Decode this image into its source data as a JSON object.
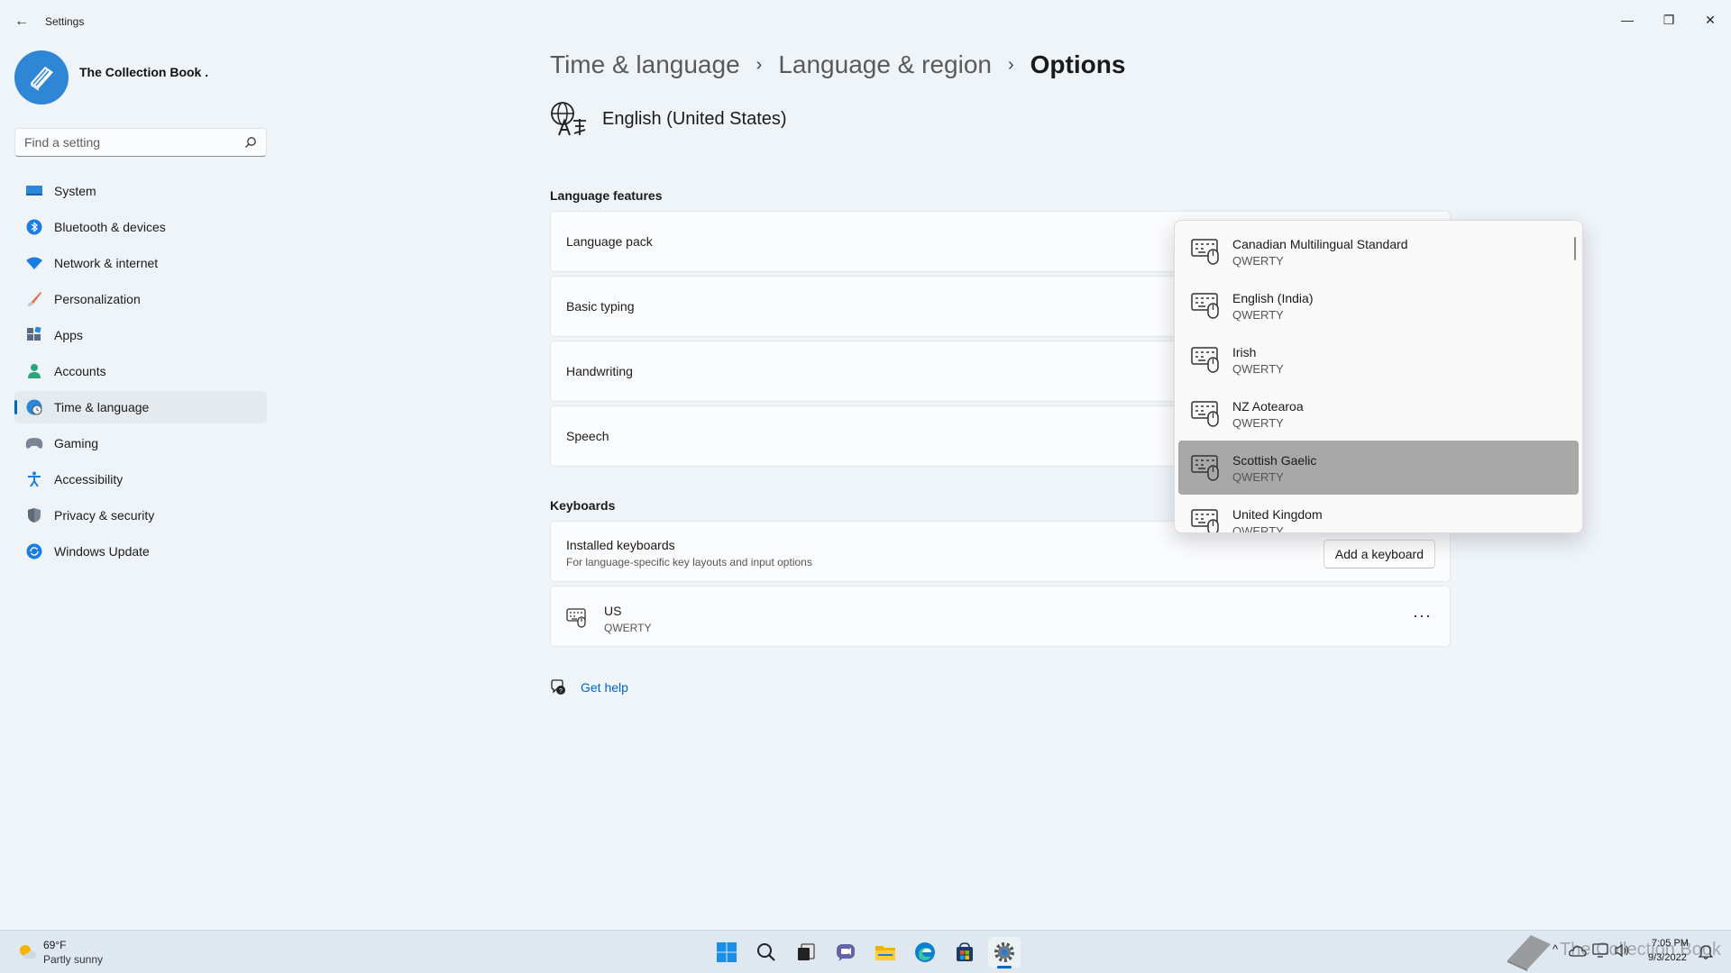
{
  "window": {
    "title": "Settings",
    "back_glyph": "←",
    "minimize_glyph": "—",
    "maximize_glyph": "❐",
    "close_glyph": "✕"
  },
  "profile": {
    "name": "The Collection Book ."
  },
  "search": {
    "placeholder": "Find a setting",
    "value": ""
  },
  "sidebar": {
    "items": [
      {
        "label": "System",
        "icon": "system-icon",
        "active": false
      },
      {
        "label": "Bluetooth & devices",
        "icon": "bluetooth-icon",
        "active": false
      },
      {
        "label": "Network & internet",
        "icon": "wifi-icon",
        "active": false
      },
      {
        "label": "Personalization",
        "icon": "brush-icon",
        "active": false
      },
      {
        "label": "Apps",
        "icon": "apps-icon",
        "active": false
      },
      {
        "label": "Accounts",
        "icon": "account-icon",
        "active": false
      },
      {
        "label": "Time & language",
        "icon": "globe-clock-icon",
        "active": true
      },
      {
        "label": "Gaming",
        "icon": "gamepad-icon",
        "active": false
      },
      {
        "label": "Accessibility",
        "icon": "accessibility-icon",
        "active": false
      },
      {
        "label": "Privacy & security",
        "icon": "shield-icon",
        "active": false
      },
      {
        "label": "Windows Update",
        "icon": "update-icon",
        "active": false
      }
    ]
  },
  "breadcrumb": {
    "items": [
      "Time & language",
      "Language & region",
      "Options"
    ],
    "separator": "›"
  },
  "language": {
    "name": "English (United States)"
  },
  "features": {
    "title": "Language features",
    "items": [
      "Language pack",
      "Basic typing",
      "Handwriting",
      "Speech"
    ]
  },
  "keyboards": {
    "title": "Keyboards",
    "installed_title": "Installed keyboards",
    "installed_subtitle": "For language-specific key layouts and input options",
    "add_button": "Add a keyboard",
    "list": [
      {
        "name": "US",
        "layout": "QWERTY"
      }
    ],
    "more_glyph": "···"
  },
  "help": {
    "label": "Get help"
  },
  "flyout": {
    "items": [
      {
        "name": "Canadian Multilingual Standard",
        "layout": "QWERTY",
        "selected": false
      },
      {
        "name": "English (India)",
        "layout": "QWERTY",
        "selected": false
      },
      {
        "name": "Irish",
        "layout": "QWERTY",
        "selected": false
      },
      {
        "name": "NZ Aotearoa",
        "layout": "QWERTY",
        "selected": false
      },
      {
        "name": "Scottish Gaelic",
        "layout": "QWERTY",
        "selected": true
      },
      {
        "name": "United Kingdom",
        "layout": "QWERTY",
        "selected": false
      }
    ]
  },
  "taskbar": {
    "weather_temp": "69°F",
    "weather_desc": "Partly sunny",
    "apps": [
      "start-icon",
      "search-icon",
      "task-view-icon",
      "chat-icon",
      "file-explorer-icon",
      "edge-icon",
      "store-icon",
      "settings-icon"
    ],
    "active_app": "settings-icon",
    "clock_time": "7:05 PM",
    "clock_date": "9/3/2022",
    "tray_expand_glyph": "^",
    "watermark": "The Collection Book"
  },
  "colors": {
    "accent": "#0067c0",
    "background": "#eff4f9",
    "card": "#fbfcfe",
    "flyout_selected": "#a8a8a8",
    "avatar": "#2f86d4"
  }
}
